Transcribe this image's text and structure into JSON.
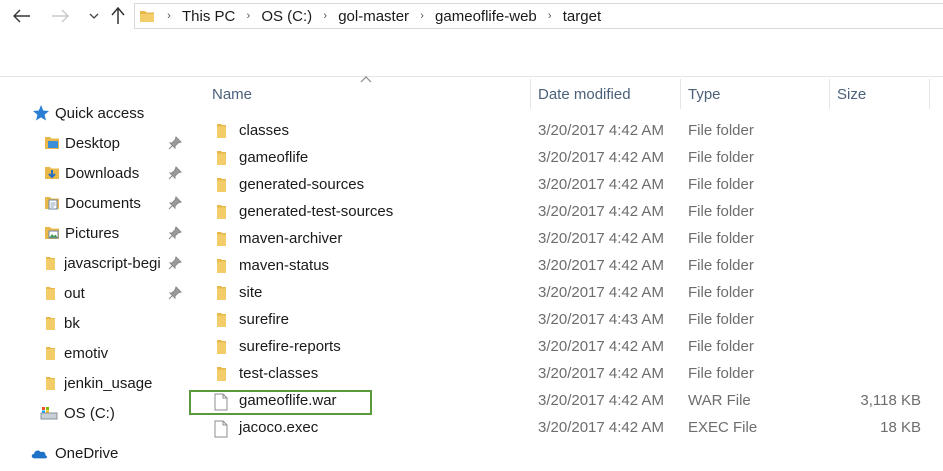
{
  "breadcrumbs": [
    "This PC",
    "OS (C:)",
    "gol-master",
    "gameoflife-web",
    "target"
  ],
  "icons": {
    "back": "back-arrow-icon",
    "forward": "forward-arrow-icon",
    "recent": "chevron-down-icon",
    "up": "up-arrow-icon"
  },
  "sidebar": {
    "items": [
      {
        "label": "Quick access",
        "icon": "star-icon",
        "pinned": false
      },
      {
        "label": "Desktop",
        "icon": "desktop-icon",
        "pinned": true
      },
      {
        "label": "Downloads",
        "icon": "downloads-icon",
        "pinned": true
      },
      {
        "label": "Documents",
        "icon": "documents-icon",
        "pinned": true
      },
      {
        "label": "Pictures",
        "icon": "pictures-icon",
        "pinned": true
      },
      {
        "label": "javascript-begi",
        "icon": "folder-icon",
        "pinned": true
      },
      {
        "label": "out",
        "icon": "folder-icon",
        "pinned": true
      },
      {
        "label": "bk",
        "icon": "folder-icon",
        "pinned": false
      },
      {
        "label": "emotiv",
        "icon": "folder-icon",
        "pinned": false
      },
      {
        "label": "jenkin_usage",
        "icon": "folder-icon",
        "pinned": false
      },
      {
        "label": "OS (C:)",
        "icon": "drive-icon",
        "pinned": false
      },
      {
        "label": "OneDrive",
        "icon": "cloud-icon",
        "pinned": false
      }
    ]
  },
  "columns": {
    "name": "Name",
    "date": "Date modified",
    "type": "Type",
    "size": "Size"
  },
  "files": [
    {
      "name": "classes",
      "date": "3/20/2017 4:42 AM",
      "type": "File folder",
      "size": "",
      "kind": "folder"
    },
    {
      "name": "gameoflife",
      "date": "3/20/2017 4:42 AM",
      "type": "File folder",
      "size": "",
      "kind": "folder"
    },
    {
      "name": "generated-sources",
      "date": "3/20/2017 4:42 AM",
      "type": "File folder",
      "size": "",
      "kind": "folder"
    },
    {
      "name": "generated-test-sources",
      "date": "3/20/2017 4:42 AM",
      "type": "File folder",
      "size": "",
      "kind": "folder"
    },
    {
      "name": "maven-archiver",
      "date": "3/20/2017 4:42 AM",
      "type": "File folder",
      "size": "",
      "kind": "folder"
    },
    {
      "name": "maven-status",
      "date": "3/20/2017 4:42 AM",
      "type": "File folder",
      "size": "",
      "kind": "folder"
    },
    {
      "name": "site",
      "date": "3/20/2017 4:42 AM",
      "type": "File folder",
      "size": "",
      "kind": "folder"
    },
    {
      "name": "surefire",
      "date": "3/20/2017 4:43 AM",
      "type": "File folder",
      "size": "",
      "kind": "folder"
    },
    {
      "name": "surefire-reports",
      "date": "3/20/2017 4:42 AM",
      "type": "File folder",
      "size": "",
      "kind": "folder"
    },
    {
      "name": "test-classes",
      "date": "3/20/2017 4:42 AM",
      "type": "File folder",
      "size": "",
      "kind": "folder"
    },
    {
      "name": "gameoflife.war",
      "date": "3/20/2017 4:42 AM",
      "type": "WAR File",
      "size": "3,118 KB",
      "kind": "file"
    },
    {
      "name": "jacoco.exec",
      "date": "3/20/2017 4:42 AM",
      "type": "EXEC File",
      "size": "18 KB",
      "kind": "file"
    }
  ],
  "colors": {
    "folder": "#e8b84a",
    "highlight": "#5a9a3a",
    "header_text": "#4c607a"
  }
}
